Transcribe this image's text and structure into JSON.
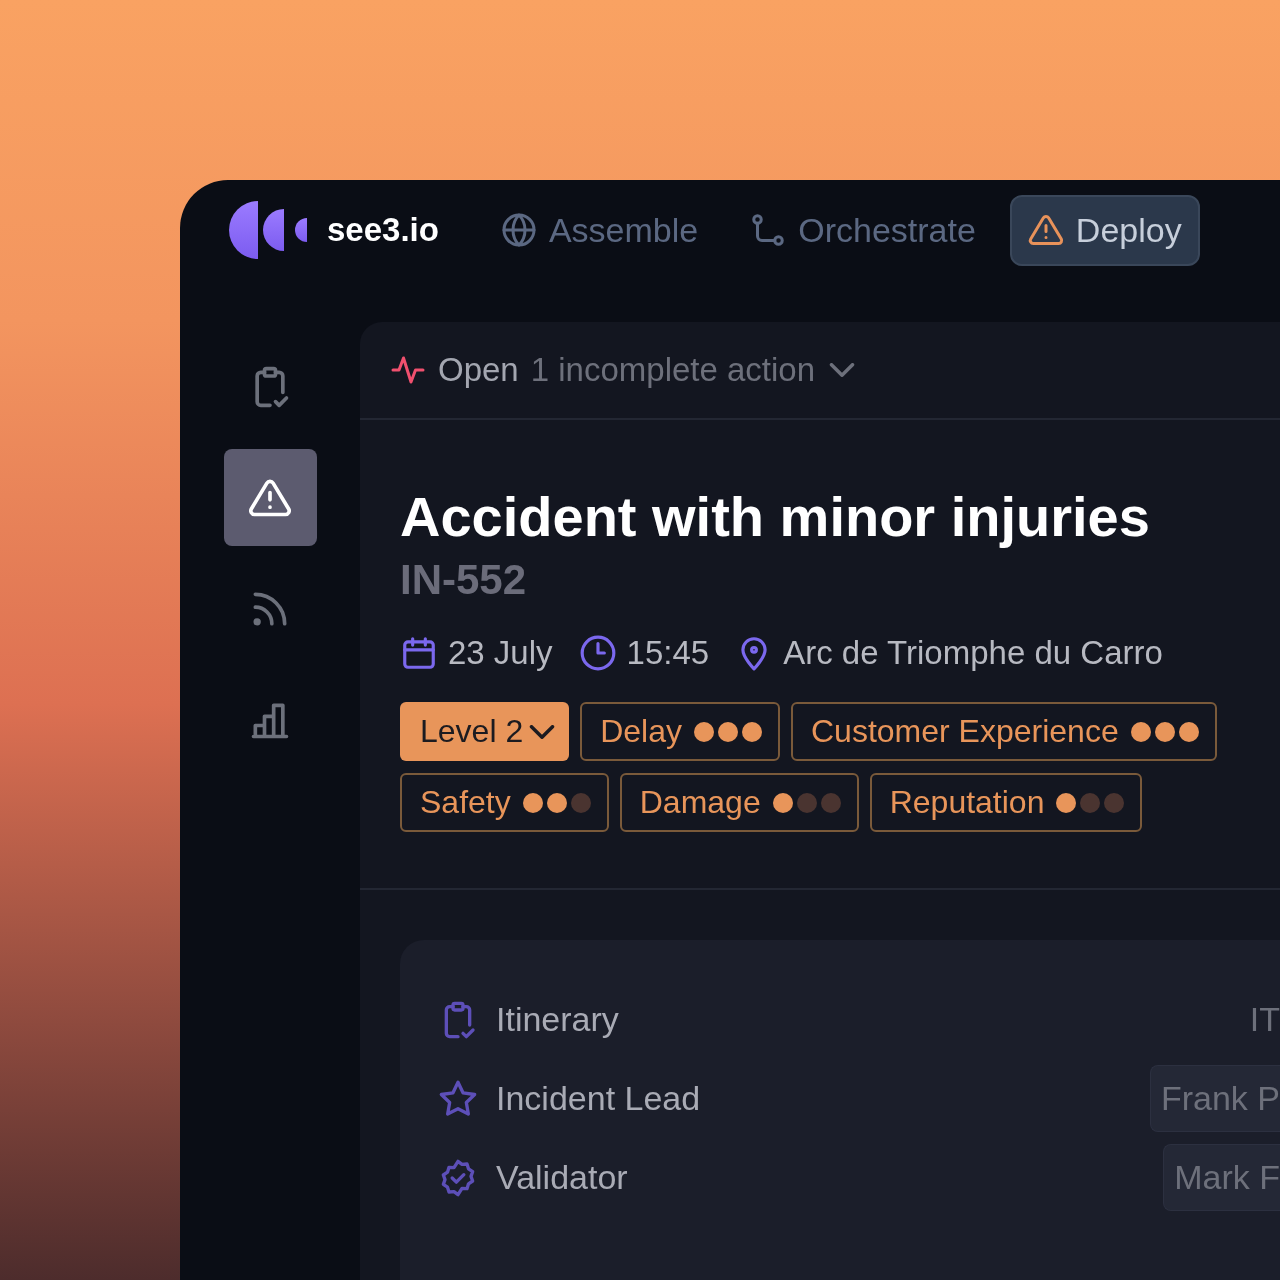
{
  "brand": {
    "name": "see3.io"
  },
  "nav": [
    {
      "label": "Assemble",
      "selected": false
    },
    {
      "label": "Orchestrate",
      "selected": false
    },
    {
      "label": "Deploy",
      "selected": true
    }
  ],
  "sidebar": {
    "items": [
      {
        "selected": false
      },
      {
        "selected": true
      },
      {
        "selected": false
      },
      {
        "selected": false
      }
    ]
  },
  "incident": {
    "status": "Open",
    "actions": "1 incomplete action",
    "title": "Accident with minor injuries",
    "id": "IN-552",
    "date": "23 July",
    "time": "15:45",
    "location": "Arc de Triomphe du Carro",
    "level": "Level 2",
    "tags": [
      {
        "label": "Delay",
        "stars": 3
      },
      {
        "label": "Customer Experience",
        "stars": 3
      },
      {
        "label": "Safety",
        "stars": 2
      },
      {
        "label": "Damage",
        "stars": 1
      },
      {
        "label": "Reputation",
        "stars": 1
      }
    ]
  },
  "details": [
    {
      "label": "Itinerary",
      "value": "IT",
      "kind": "text"
    },
    {
      "label": "Incident Lead",
      "value": "Frank P",
      "kind": "field"
    },
    {
      "label": "Validator",
      "value": "Mark F",
      "kind": "field"
    }
  ]
}
